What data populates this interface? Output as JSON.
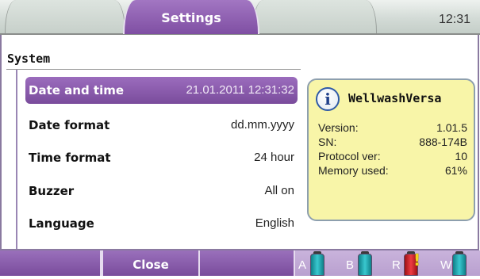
{
  "header": {
    "active_tab": "Settings",
    "clock": "12:31"
  },
  "section": {
    "title": "System"
  },
  "settings": [
    {
      "label": "Date and time",
      "value": "21.01.2011 12:31:32",
      "selected": true
    },
    {
      "label": "Date format",
      "value": "dd.mm.yyyy",
      "selected": false
    },
    {
      "label": "Time format",
      "value": "24 hour",
      "selected": false
    },
    {
      "label": "Buzzer",
      "value": "All on",
      "selected": false
    },
    {
      "label": "Language",
      "value": "English",
      "selected": false
    }
  ],
  "info": {
    "icon": "info-icon",
    "title": "WellwashVersa",
    "rows": [
      {
        "key": "Version:",
        "value": "1.01.5"
      },
      {
        "key": "SN:",
        "value": "888-174B"
      },
      {
        "key": "Protocol ver:",
        "value": "10"
      },
      {
        "key": "Memory used:",
        "value": "61%"
      }
    ]
  },
  "footer": {
    "close_label": "Close",
    "bottles": [
      {
        "letter": "A",
        "color": "#1fa7b0",
        "warning": false
      },
      {
        "letter": "B",
        "color": "#1fa7b0",
        "warning": false
      },
      {
        "letter": "R",
        "color": "#d8232a",
        "warning": true
      },
      {
        "letter": "W",
        "color": "#1fa7b0",
        "warning": false
      }
    ]
  },
  "colors": {
    "accent": "#8a5bb0",
    "info_bg": "#f8f5a8"
  }
}
